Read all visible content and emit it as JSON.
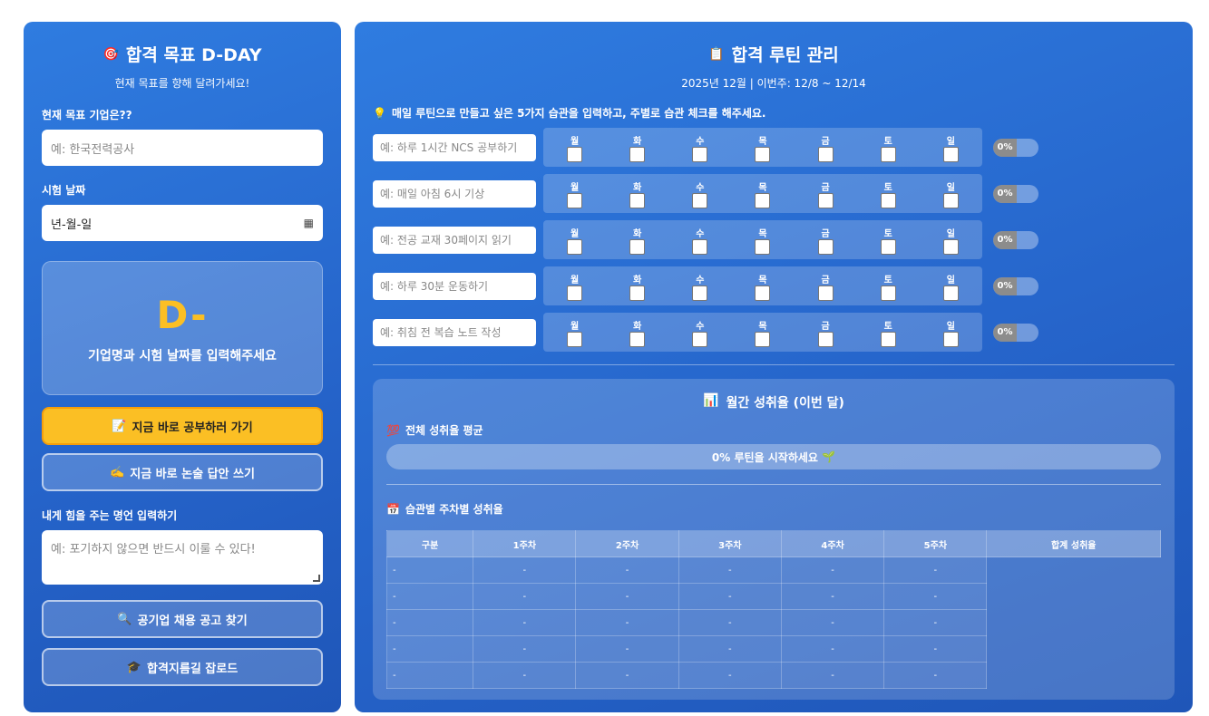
{
  "left": {
    "title": "합격 목표 D-DAY",
    "subtitle": "현재 목표를 향해 달려가세요!",
    "company_label": "현재 목표 기업은??",
    "company_placeholder": "예: 한국전력공사",
    "date_label": "시험 날짜",
    "date_value": "년-월-일",
    "dday_text": "D-",
    "dday_message": "기업명과 시험 날짜를 입력해주세요",
    "study_button": "지금 바로 공부하러 가기",
    "essay_button": "지금 바로 논술 답안 쓰기",
    "quote_label": "내게 힘을 주는 명언 입력하기",
    "quote_placeholder": "예: 포기하지 않으면 반드시 이룰 수 있다!",
    "job_button": "공기업 채용 공고 찾기",
    "roadmap_button": "합격지름길 잡로드"
  },
  "right": {
    "title": "합격 루틴 관리",
    "period": "2025년 12월 | 이번주: 12/8 ~ 12/14",
    "tip": "매일 루틴으로 만들고 싶은 5가지 습관을 입력하고, 주별로 습관 체크를 해주세요.",
    "days": [
      "월",
      "화",
      "수",
      "목",
      "금",
      "토",
      "일"
    ],
    "habits": [
      {
        "placeholder": "예: 하루 1시간 NCS 공부하기",
        "percent": "0%"
      },
      {
        "placeholder": "예: 매일 아침 6시 기상",
        "percent": "0%"
      },
      {
        "placeholder": "예: 전공 교재 30페이지 읽기",
        "percent": "0%"
      },
      {
        "placeholder": "예: 하루 30분 운동하기",
        "percent": "0%"
      },
      {
        "placeholder": "예: 취침 전 복습 노트 작성",
        "percent": "0%"
      }
    ],
    "stats_title": "월간 성취율 (이번 달)",
    "overall_label": "전체 성취율 평균",
    "overall_text": "0% 루틴을 시작하세요",
    "weekly_label": "습관별 주차별 성취율",
    "table_headers": [
      "구분",
      "1주차",
      "2주차",
      "3주차",
      "4주차",
      "5주차",
      "합계 성취율"
    ],
    "table_rows": [
      [
        "-",
        "-",
        "-",
        "-",
        "-",
        "-"
      ],
      [
        "-",
        "-",
        "-",
        "-",
        "-",
        "-"
      ],
      [
        "-",
        "-",
        "-",
        "-",
        "-",
        "-"
      ],
      [
        "-",
        "-",
        "-",
        "-",
        "-",
        "-"
      ],
      [
        "-",
        "-",
        "-",
        "-",
        "-",
        "-"
      ]
    ]
  },
  "colors": {
    "panel": "#2563c9",
    "accent": "#fbbf24"
  }
}
